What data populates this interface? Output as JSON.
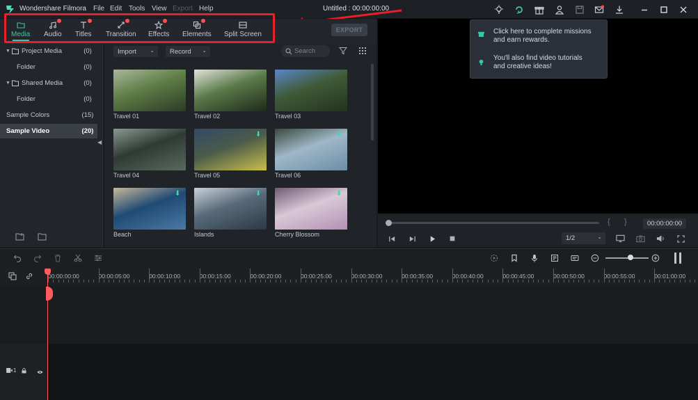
{
  "app": {
    "name": "Wondershare Filmora",
    "doc_title": "Untitled : 00:00:00:00"
  },
  "menu": [
    "File",
    "Edit",
    "Tools",
    "View",
    "Export",
    "Help"
  ],
  "titlebar_icons": [
    "bulb-icon",
    "sync-icon",
    "gift-icon",
    "account-icon",
    "save-icon",
    "mail-icon",
    "download-icon",
    "minimize-icon",
    "maximize-icon",
    "close-icon"
  ],
  "tabs": [
    {
      "label": "Media",
      "icon": "folder-icon",
      "active": true,
      "dot": false
    },
    {
      "label": "Audio",
      "icon": "music-icon",
      "active": false,
      "dot": true
    },
    {
      "label": "Titles",
      "icon": "text-icon",
      "active": false,
      "dot": true
    },
    {
      "label": "Transition",
      "icon": "transition-icon",
      "active": false,
      "dot": true
    },
    {
      "label": "Effects",
      "icon": "effects-icon",
      "active": false,
      "dot": true
    },
    {
      "label": "Elements",
      "icon": "elements-icon",
      "active": false,
      "dot": true
    },
    {
      "label": "Split Screen",
      "icon": "split-screen-icon",
      "active": false,
      "dot": false
    }
  ],
  "export_label": "EXPORT",
  "sidebar": [
    {
      "label": "Project Media",
      "count": "(0)",
      "expandable": true
    },
    {
      "label": "Folder",
      "count": "(0)",
      "indent": true
    },
    {
      "label": "Shared Media",
      "count": "(0)",
      "expandable": true
    },
    {
      "label": "Folder",
      "count": "(0)",
      "indent": true
    },
    {
      "label": "Sample Colors",
      "count": "(15)"
    },
    {
      "label": "Sample Video",
      "count": "(20)",
      "active": true
    }
  ],
  "browser": {
    "import_label": "Import",
    "record_label": "Record",
    "search_placeholder": "Search",
    "items": [
      {
        "label": "Travel 01",
        "colors": [
          "#5d7d46",
          "#2d3b26",
          "#aab79a"
        ],
        "download": false
      },
      {
        "label": "Travel 02",
        "colors": [
          "#5a7a4a",
          "#1f2a1a",
          "#e3e3dc"
        ],
        "download": false
      },
      {
        "label": "Travel 03",
        "colors": [
          "#3f5a36",
          "#24331f",
          "#5b86c8"
        ],
        "download": false
      },
      {
        "label": "Travel 04",
        "colors": [
          "#2e3a33",
          "#5a6a5e",
          "#8c9a90"
        ],
        "download": false
      },
      {
        "label": "Travel 05",
        "colors": [
          "#4b5b4a",
          "#c9bf4a",
          "#314a68"
        ],
        "download": true
      },
      {
        "label": "Travel 06",
        "colors": [
          "#9fb7c8",
          "#6b8ea6",
          "#3a4b3c"
        ],
        "download": true
      },
      {
        "label": "Beach",
        "colors": [
          "#1f4a74",
          "#4b7aa6",
          "#c8b89a"
        ],
        "download": true
      },
      {
        "label": "Islands",
        "colors": [
          "#586a7a",
          "#2b3945",
          "#c9d1d8"
        ],
        "download": true
      },
      {
        "label": "Cherry Blossom",
        "colors": [
          "#d8c9d6",
          "#b48fb6",
          "#6f5b74"
        ],
        "download": true
      }
    ]
  },
  "tooltip": {
    "line1a": "Click here to complete missions",
    "line1b": "and earn rewards.",
    "line2a": "You'll also find video tutorials",
    "line2b": "and creative ideas!"
  },
  "preview": {
    "time": "00:00:00:00",
    "ratio": "1/2",
    "progress": 0
  },
  "timeline": {
    "ticks": [
      "00:00:00:00",
      "00:00:05:00",
      "00:00:10:00",
      "00:00:15:00",
      "00:00:20:00",
      "00:00:25:00",
      "00:00:30:00",
      "00:00:35:00",
      "00:00:40:00",
      "00:00:45:00",
      "00:00:50:00",
      "00:00:55:00",
      "00:01:00:00"
    ],
    "track_label": "1"
  },
  "colors": {
    "accent": "#3bc6a9",
    "highlight": "#e8202a",
    "playhead": "#ff5d5d"
  }
}
